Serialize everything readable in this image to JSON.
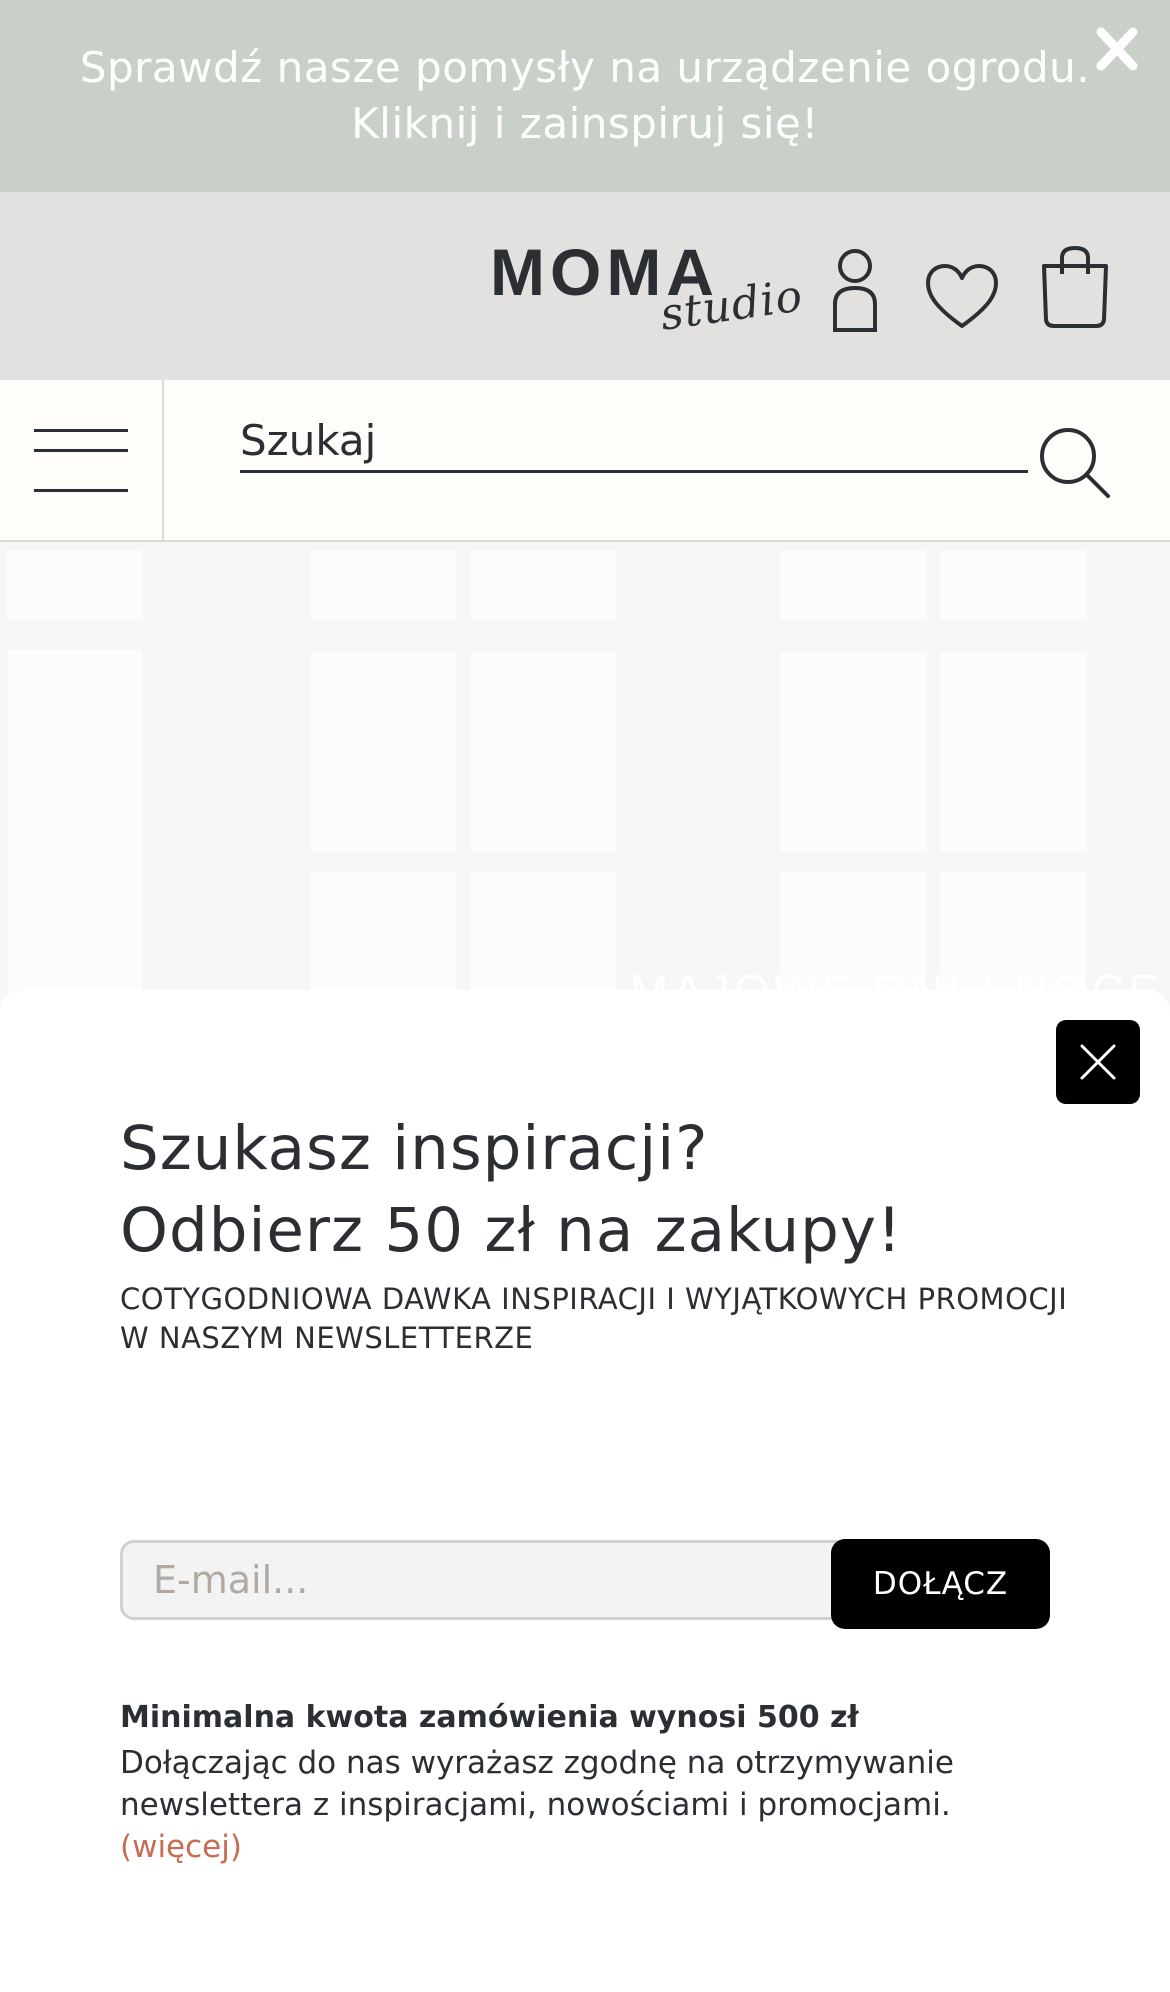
{
  "promo_bar": {
    "line1": "Sprawdź nasze pomysły na urządzenie ogrodu.",
    "line2": "Kliknij i zainspiruj się!",
    "background": "#c8d0c8"
  },
  "header": {
    "logo_main": "MOMA",
    "logo_sub": "studio",
    "icons": [
      "user-icon",
      "heart-icon",
      "shopping-bag-icon"
    ],
    "background": "#e3e1df"
  },
  "search": {
    "placeholder": "Szukaj"
  },
  "hero": {
    "caption": "MAJOWE DNI I NOCE"
  },
  "newsletter": {
    "headline_line1": "Szukasz inspiracji?",
    "headline_line2": "Odbierz 50 zł na zakupy!",
    "subline": "COTYGODNIOWA DAWKA INSPIRACJI I WYJĄTKOWYCH PROMOCJI W NASZYM NEWSLETTERZE",
    "email_placeholder": "E-mail...",
    "join_label": "DOŁĄCZ",
    "min_order": "Minimalna kwota zamówienia wynosi 500 zł",
    "consent": "Dołączając do nas wyrażasz zgodnę na otrzymywanie newslettera z inspiracjami, nowościami i promocjami.",
    "more_link": "(więcej)",
    "accent_link_color": "#c86c55"
  }
}
